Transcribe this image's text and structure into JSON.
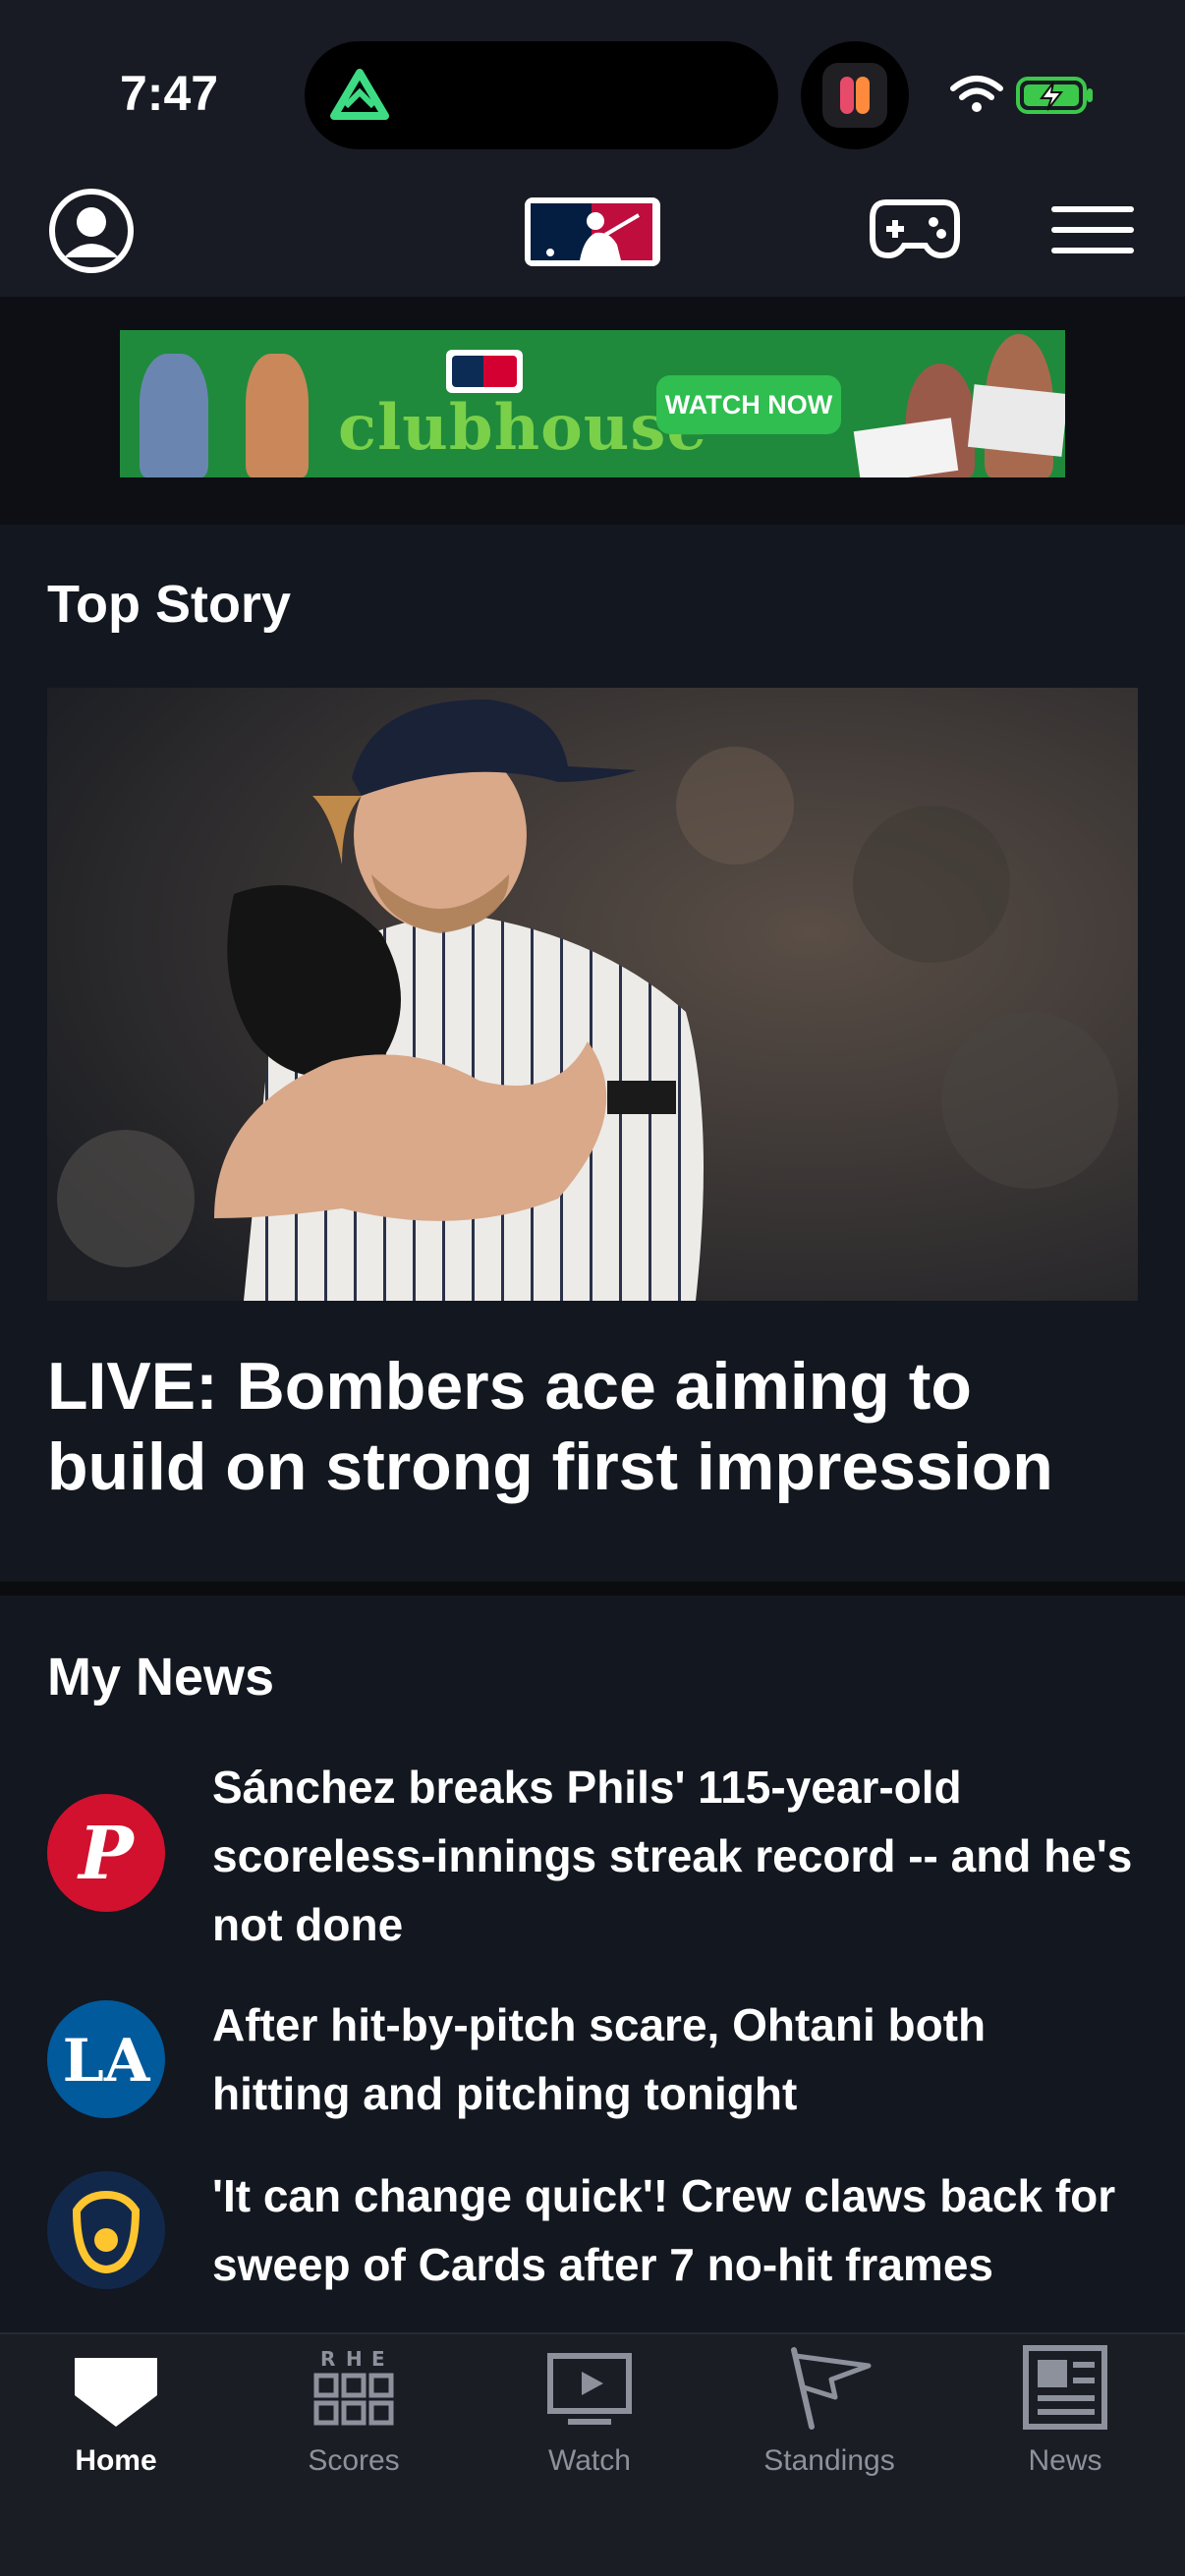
{
  "status_bar": {
    "time": "7:47"
  },
  "header": {
    "profile_icon": "user-circle-icon",
    "logo": "mlb-logo",
    "game_icon": "gamepad-icon",
    "menu_icon": "hamburger-menu-icon"
  },
  "ad": {
    "brand": "clubhouse",
    "cta": "WATCH NOW"
  },
  "top_story": {
    "section_title": "Top Story",
    "headline": "LIVE: Bombers ace aiming to build on strong first impression"
  },
  "my_news": {
    "section_title": "My News",
    "items": [
      {
        "team": "Phillies",
        "logo_color": "#c8102e",
        "headline": "Sánchez breaks Phils' 115-year-old scoreless-innings streak record -- and he's not done"
      },
      {
        "team": "Dodgers",
        "logo_color": "#005a9c",
        "headline": "After hit-by-pitch scare, Ohtani both hitting and pitching tonight"
      },
      {
        "team": "Brewers",
        "logo_color": "#12284b",
        "headline": "'It can change quick'! Crew claws back for sweep of Cards after 7 no-hit frames"
      }
    ]
  },
  "tabs": [
    {
      "label": "Home",
      "icon": "home-plate-icon",
      "active": true
    },
    {
      "label": "Scores",
      "icon": "scores-grid-icon",
      "active": false
    },
    {
      "label": "Watch",
      "icon": "watch-play-icon",
      "active": false
    },
    {
      "label": "Standings",
      "icon": "standings-flag-icon",
      "active": false
    },
    {
      "label": "News",
      "icon": "news-icon",
      "active": false
    }
  ],
  "colors": {
    "background": "#121720",
    "header": "#181b23",
    "ad_green": "#1f8a3c",
    "tab_inactive": "#8d919c"
  }
}
